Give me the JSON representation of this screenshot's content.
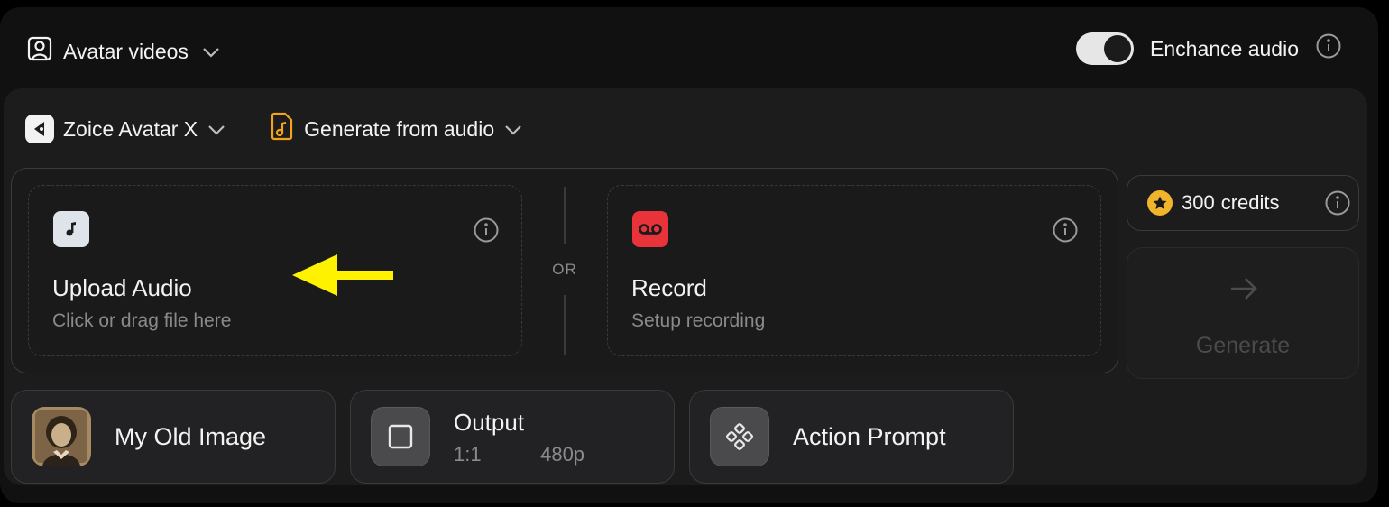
{
  "header": {
    "mode_label": "Avatar videos",
    "enhance_label": "Enchance audio",
    "enhance_on": true
  },
  "selectors": {
    "model_label": "Zoice Avatar X",
    "source_label": "Generate from audio"
  },
  "upload_card": {
    "title": "Upload Audio",
    "subtitle": "Click or drag file here"
  },
  "divider": {
    "text": "OR"
  },
  "record_card": {
    "title": "Record",
    "subtitle": "Setup recording"
  },
  "credits": {
    "count": "300",
    "label": "credits"
  },
  "generate": {
    "label": "Generate"
  },
  "chips": {
    "image_label": "My Old Image",
    "output_title": "Output",
    "output_ratio": "1:1",
    "output_resolution": "480p",
    "action_label": "Action Prompt"
  },
  "colors": {
    "background": "#000000",
    "panel": "#1c1c1d",
    "record_accent": "#e8333b",
    "credits_star": "#f1b52d",
    "annotation_arrow": "#fff200"
  },
  "icons": {
    "mode": "user-square-icon",
    "model": "zoice-logo-icon",
    "source": "audio-file-icon",
    "upload": "music-note-icon",
    "record": "voicemail-icon",
    "credits": "star-coin-icon",
    "generate": "arrow-right-icon",
    "output": "square-icon",
    "action": "diamond-dots-icon"
  }
}
